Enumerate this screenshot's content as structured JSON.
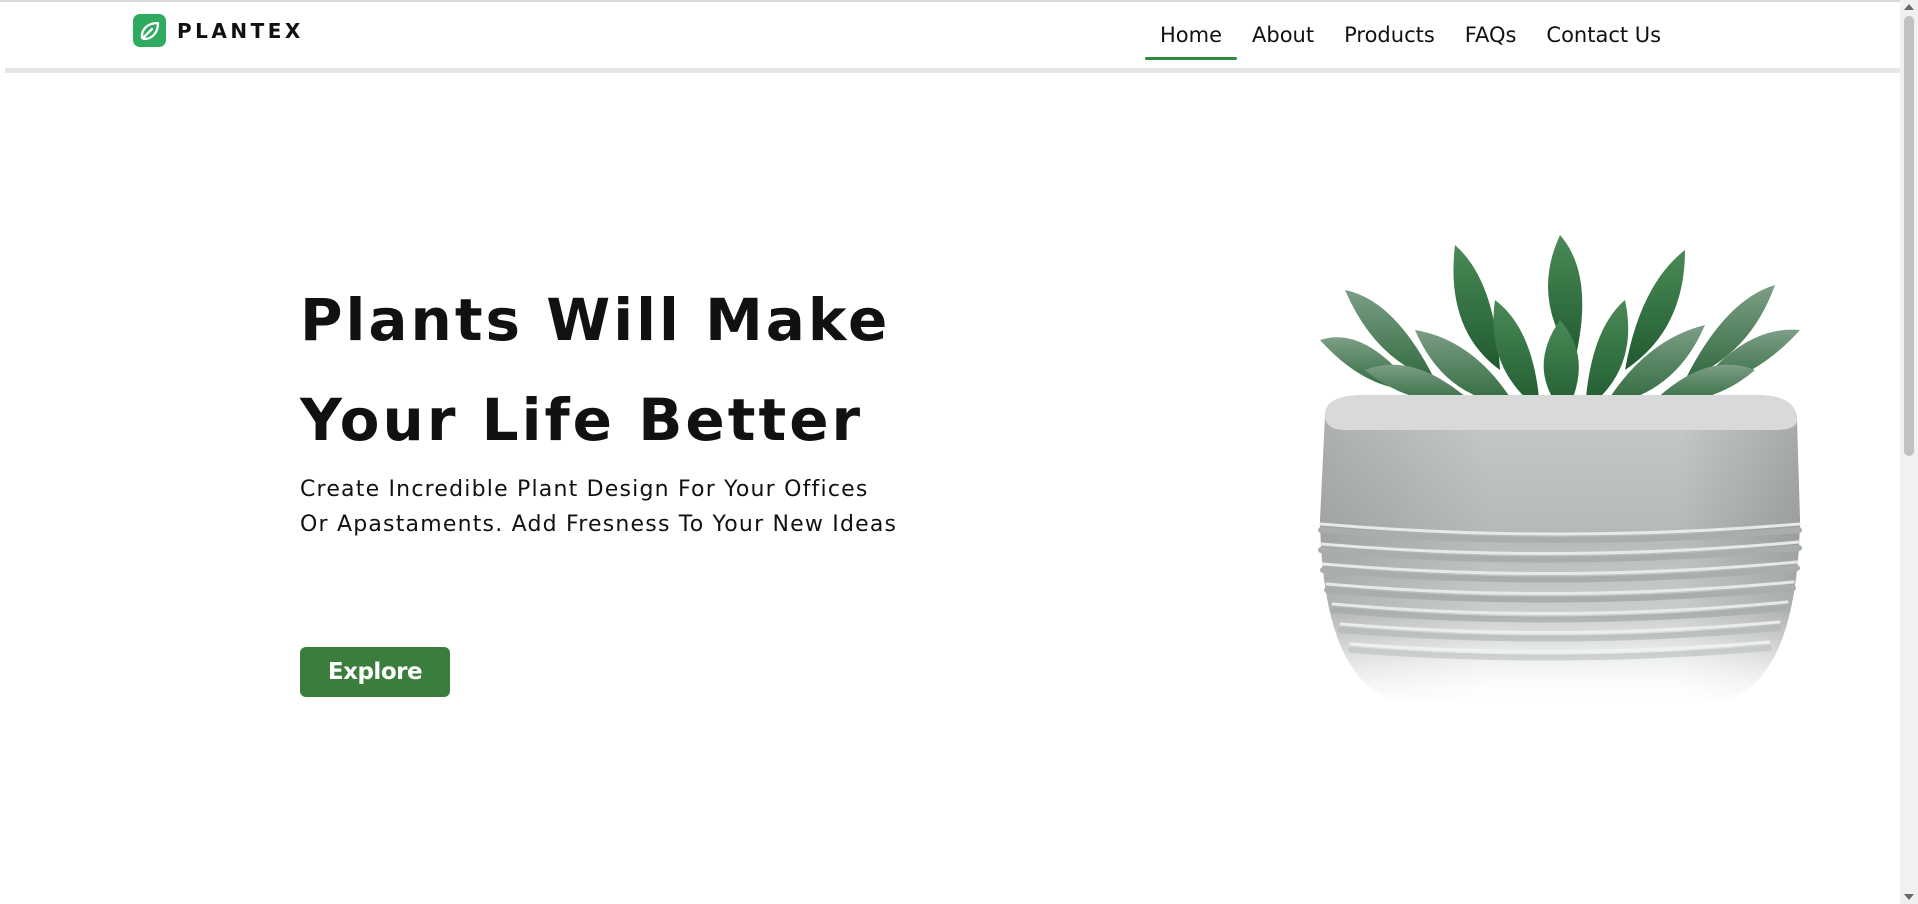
{
  "brand": {
    "name": "PLANTEX",
    "icon": "leaf-icon",
    "color": "#2eab60"
  },
  "nav": {
    "items": [
      {
        "label": "Home",
        "active": true
      },
      {
        "label": "About",
        "active": false
      },
      {
        "label": "Products",
        "active": false
      },
      {
        "label": "FAQs",
        "active": false
      },
      {
        "label": "Contact Us",
        "active": false
      }
    ],
    "active_indicator_color": "#2e8b3e"
  },
  "hero": {
    "title_line1": "Plants Will Make",
    "title_line2": "Your Life Better",
    "subtitle": "Create Incredible Plant Design For Your Offices Or Apastaments. Add Fresness To Your New Ideas",
    "button_label": "Explore",
    "button_color": "#3a7d3d",
    "image": "succulent-in-concrete-pot"
  }
}
